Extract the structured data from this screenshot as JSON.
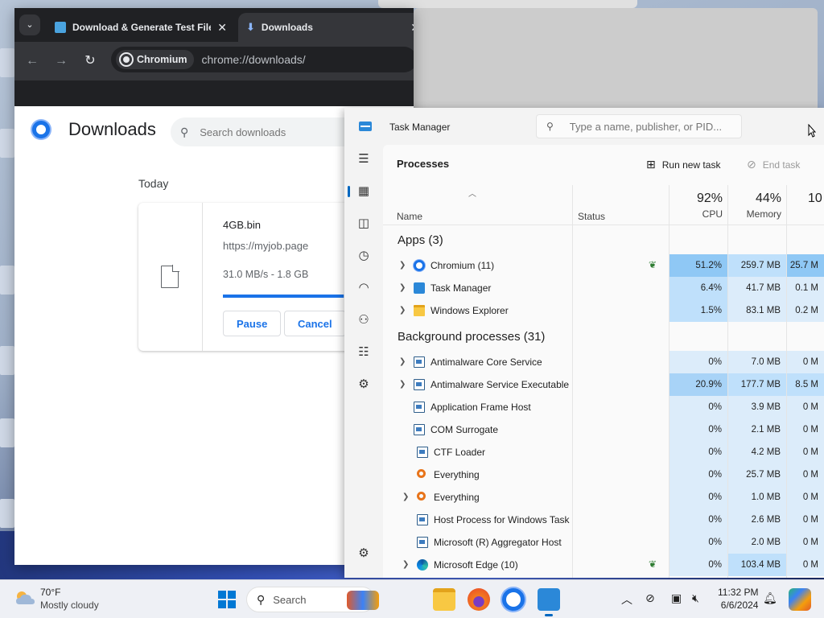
{
  "browser": {
    "tabs": [
      {
        "label": "Download & Generate Test File"
      },
      {
        "label": "Downloads"
      }
    ],
    "chip_label": "Chromium",
    "url": "chrome://downloads/"
  },
  "downloads": {
    "title": "Downloads",
    "search_placeholder": "Search downloads",
    "section": "Today",
    "item": {
      "filename": "4GB.bin",
      "source": "https://myjob.page",
      "status": "31.0 MB/s - 1.8 GB",
      "progress": 0.77,
      "pause_label": "Pause",
      "cancel_label": "Cancel"
    }
  },
  "task_manager": {
    "title": "Task Manager",
    "search_placeholder": "Type a name, publisher, or PID...",
    "page_title": "Processes",
    "run_new_task": "Run new task",
    "end_task": "End task",
    "columns": {
      "name": "Name",
      "status": "Status",
      "cpu_pct": "92%",
      "cpu": "CPU",
      "mem_pct": "44%",
      "mem": "Memory",
      "disk_pct": "10"
    },
    "apps_group": "Apps (3)",
    "apps": [
      {
        "name": "Chromium (11)",
        "cpu": "51.2%",
        "mem": "259.7 MB",
        "disk": "25.7 M"
      },
      {
        "name": "Task Manager",
        "cpu": "6.4%",
        "mem": "41.7 MB",
        "disk": "0.1 M"
      },
      {
        "name": "Windows Explorer",
        "cpu": "1.5%",
        "mem": "83.1 MB",
        "disk": "0.2 M"
      }
    ],
    "bg_group": "Background processes (31)",
    "background": [
      {
        "name": "Antimalware Core Service",
        "cpu": "0%",
        "mem": "7.0 MB",
        "disk": "0 M"
      },
      {
        "name": "Antimalware Service Executable",
        "cpu": "20.9%",
        "mem": "177.7 MB",
        "disk": "8.5 M"
      },
      {
        "name": "Application Frame Host",
        "cpu": "0%",
        "mem": "3.9 MB",
        "disk": "0 M"
      },
      {
        "name": "COM Surrogate",
        "cpu": "0%",
        "mem": "2.1 MB",
        "disk": "0 M"
      },
      {
        "name": "CTF Loader",
        "cpu": "0%",
        "mem": "4.2 MB",
        "disk": "0 M"
      },
      {
        "name": "Everything",
        "cpu": "0%",
        "mem": "25.7 MB",
        "disk": "0 M"
      },
      {
        "name": "Everything",
        "cpu": "0%",
        "mem": "1.0 MB",
        "disk": "0 M"
      },
      {
        "name": "Host Process for Windows Task",
        "cpu": "0%",
        "mem": "2.6 MB",
        "disk": "0 M"
      },
      {
        "name": "Microsoft (R) Aggregator Host",
        "cpu": "0%",
        "mem": "2.0 MB",
        "disk": "0 M"
      },
      {
        "name": "Microsoft Edge (10)",
        "cpu": "0%",
        "mem": "103.4 MB",
        "disk": "0 M"
      }
    ]
  },
  "taskbar": {
    "weather_temp": "70°F",
    "weather_desc": "Mostly cloudy",
    "search_label": "Search",
    "time": "11:32 PM",
    "date": "6/6/2024"
  },
  "colors": {
    "cpu_heat": "#bfe0fb",
    "cpu_heat_high": "#8fc8f5",
    "accent": "#0067c0"
  }
}
